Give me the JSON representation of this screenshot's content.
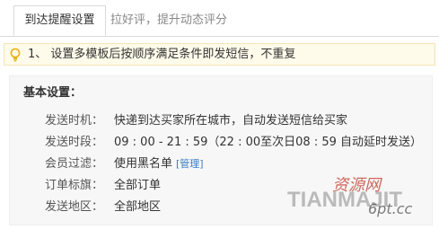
{
  "tabs": [
    {
      "label": "到达提醒设置",
      "active": true
    },
    {
      "label": "拉好评，提升动态评分",
      "active": false
    }
  ],
  "notice": {
    "text": "1、 设置多模板后按顺序满足条件即发短信，不重复"
  },
  "settings": {
    "title": "基本设置：",
    "rows": [
      {
        "label": "发送时机：",
        "value": "快递到达买家所在城市，自动发送短信给买家"
      },
      {
        "label": "发送时段：",
        "value": "09 : 00 - 21 : 59（22 : 00至次日08 : 59 自动延时发送）"
      },
      {
        "label": "会员过滤：",
        "value": "使用黑名单",
        "link": "[管理]"
      },
      {
        "label": "订单标旗：",
        "value": "全部订单"
      },
      {
        "label": "发送地区：",
        "value": "全部地区"
      }
    ]
  },
  "watermark": {
    "line1": "TIANMAJIT",
    "line2": "资源网",
    "line3": "6pt.cc"
  },
  "colors": {
    "link": "#3a7ac4",
    "notice_bg": "#fffbea",
    "panel_bg": "#f7f7f7"
  }
}
